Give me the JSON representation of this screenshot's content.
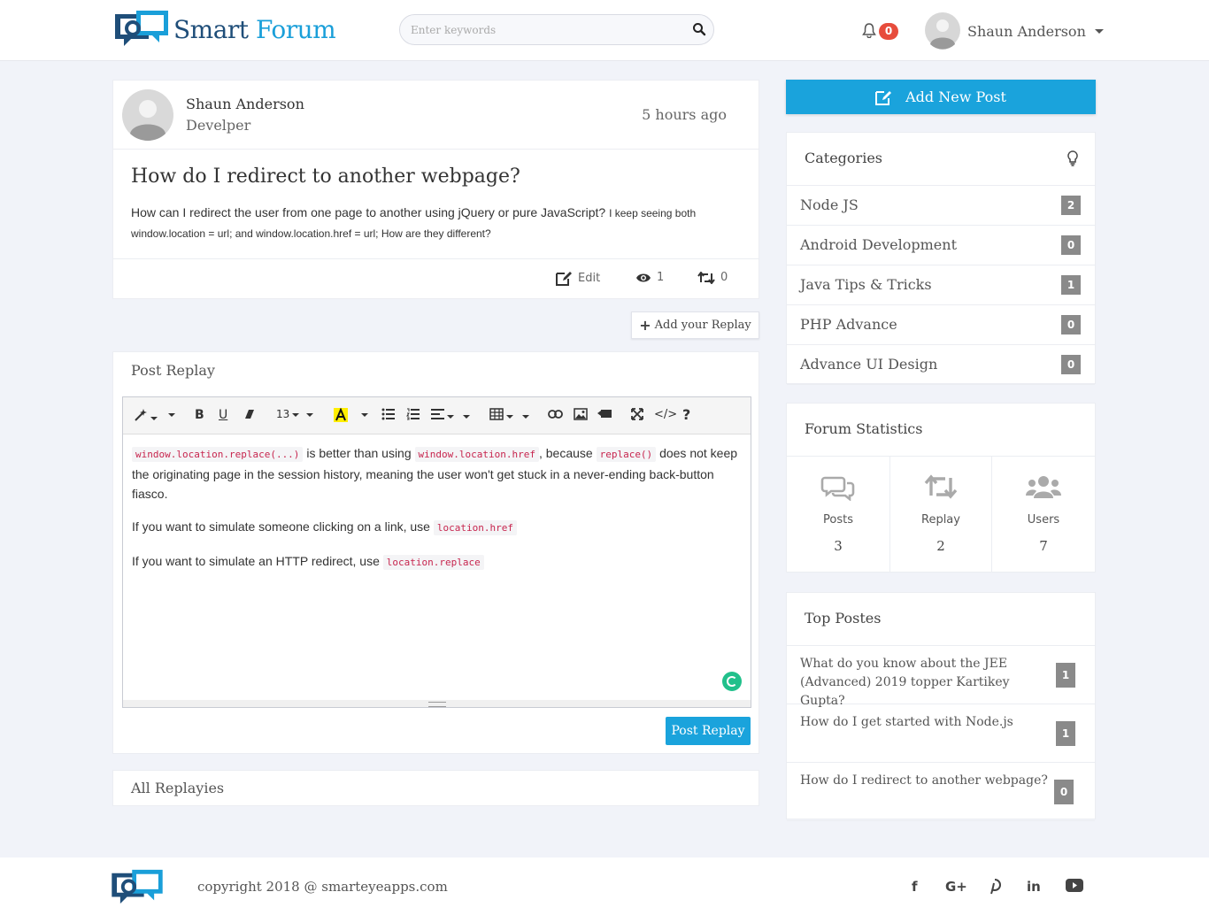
{
  "brand": {
    "name_part1": "Smart",
    "name_part2": "Forum",
    "color_dark": "#1f4e79",
    "color_accent": "#1a9fd9"
  },
  "header": {
    "search_placeholder": "Enter keywords",
    "notification_count": "0",
    "user_name": "Shaun Anderson"
  },
  "post": {
    "author": "Shaun Anderson",
    "role": "Develper",
    "time": "5 hours ago",
    "title": "How do I redirect to another webpage?",
    "body_main": "How can I redirect the user from one page to another using jQuery or pure JavaScript?",
    "body_small": "I keep seeing both window.location = url; and window.location.href = url; How are they different?",
    "edit_label": "Edit",
    "views": "1",
    "shares": "0"
  },
  "add_replay_label": "Add your Replay",
  "reply": {
    "title": "Post Replay",
    "font_size": "13",
    "p1_code1": "window.location.replace(...)",
    "p1_text1": " is better than using ",
    "p1_code2": "window.location.href",
    "p1_text2": ", because ",
    "p1_code3": "replace()",
    "p1_text3": " does not keep the originating page in the session history, meaning the user won't get stuck in a never-ending back-button fiasco.",
    "p2_text": "If you want to simulate someone clicking on a link, use ",
    "p2_code": "location.href",
    "p3_text": "If you want to simulate an HTTP redirect, use ",
    "p3_code": "location.replace",
    "submit_label": "Post Replay"
  },
  "all_replies_title": "All Replayies",
  "sidebar": {
    "new_post_label": "Add New Post",
    "categories_title": "Categories",
    "categories": [
      {
        "name": "Node JS",
        "count": "2"
      },
      {
        "name": "Android Development",
        "count": "0"
      },
      {
        "name": "Java Tips & Tricks",
        "count": "1"
      },
      {
        "name": "PHP Advance",
        "count": "0"
      },
      {
        "name": "Advance UI Design",
        "count": "0"
      }
    ],
    "stats_title": "Forum Statistics",
    "stats": [
      {
        "label": "Posts",
        "value": "3",
        "icon": "comments-icon"
      },
      {
        "label": "Replay",
        "value": "2",
        "icon": "retweet-icon"
      },
      {
        "label": "Users",
        "value": "7",
        "icon": "users-icon"
      }
    ],
    "top_title": "Top Postes",
    "top_posts": [
      {
        "title": "What do you know about the JEE (Advanced) 2019 topper Kartikey Gupta?",
        "count": "1"
      },
      {
        "title": "How do I get started with Node.js",
        "count": "1"
      },
      {
        "title": "How do I redirect to another webpage?",
        "count": "0"
      }
    ]
  },
  "footer": {
    "copyright": "copyright 2018 @ smarteyeapps.com",
    "social": [
      "f",
      "G+",
      "P",
      "in",
      "yt"
    ]
  }
}
